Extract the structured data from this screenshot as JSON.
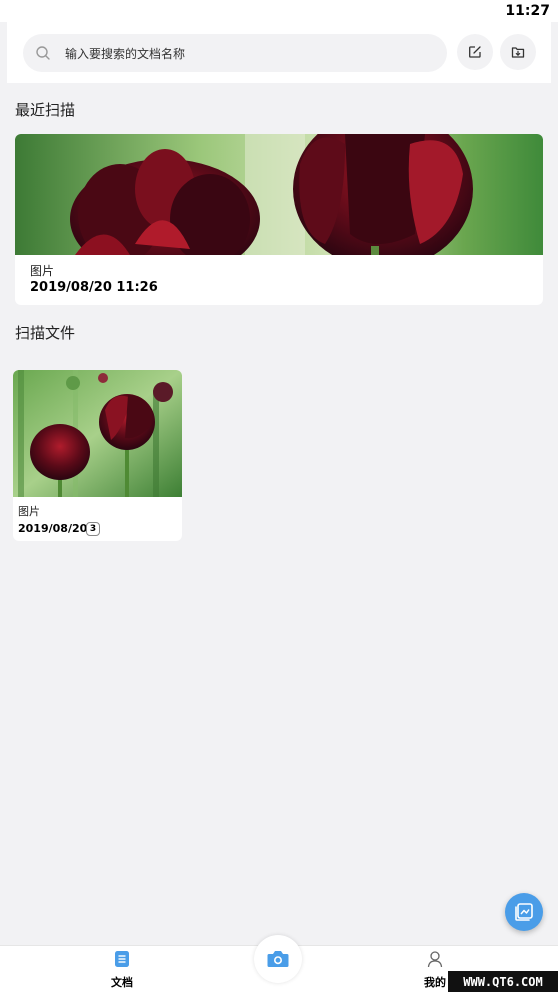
{
  "status_bar": {
    "time": "11:27"
  },
  "search": {
    "placeholder": "输入要搜索的文档名称"
  },
  "toolbar": {
    "edit_icon": "edit-icon",
    "import_icon": "import-icon"
  },
  "recent": {
    "title": "最近扫描",
    "item": {
      "name": "图片",
      "date": "2019/08/20 11:26"
    }
  },
  "files": {
    "title": "扫描文件",
    "items": [
      {
        "name": "图片",
        "date": "2019/08/20",
        "count": "3"
      }
    ]
  },
  "fab": {
    "icon": "gallery-icon"
  },
  "nav": {
    "docs_label": "文档",
    "camera_icon": "camera-icon",
    "me_label": "我的"
  },
  "watermark": {
    "text": "WWW.QT6.COM"
  },
  "colors": {
    "accent": "#4a9de8",
    "background": "#f2f2f4",
    "card": "#ffffff"
  }
}
